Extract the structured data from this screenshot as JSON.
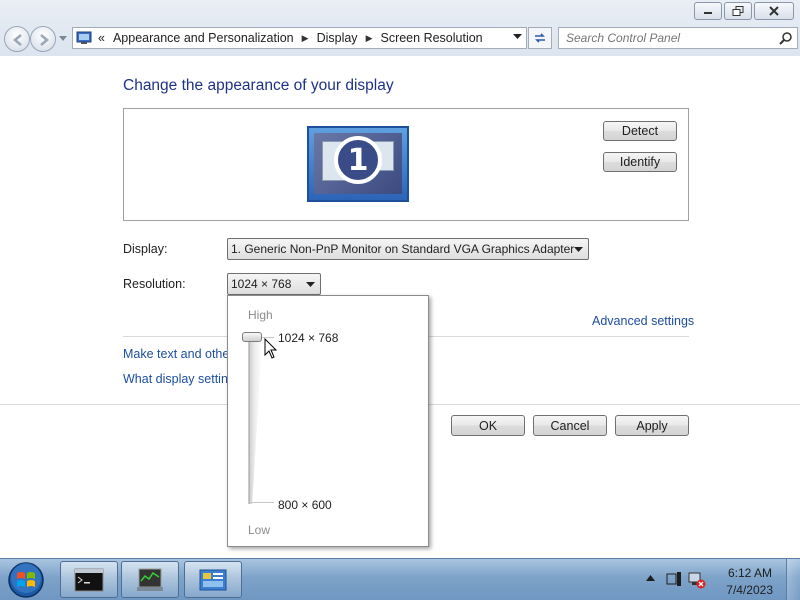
{
  "window": {
    "buttons": {
      "minimize": "minimize-icon",
      "restore": "restore-icon",
      "close": "close-icon"
    }
  },
  "navigation": {
    "back_icon": "back-arrow-icon",
    "forward_icon": "forward-arrow-icon",
    "address": {
      "prefix": "«",
      "crumbs": [
        "Appearance and Personalization",
        "Display",
        "Screen Resolution"
      ]
    },
    "search": {
      "placeholder": "Search Control Panel"
    }
  },
  "main": {
    "title": "Change the appearance of your display",
    "monitor_number": "1",
    "detect_label": "Detect",
    "identify_label": "Identify",
    "display_label": "Display:",
    "display_value": "1. Generic Non-PnP Monitor on Standard VGA Graphics Adapter",
    "resolution_label": "Resolution:",
    "resolution_value": "1024 × 768",
    "advanced_link": "Advanced settings",
    "link_text_size": "Make text and other",
    "link_display_settings": "What display setting",
    "ok_label": "OK",
    "cancel_label": "Cancel",
    "apply_label": "Apply"
  },
  "resolution_popup": {
    "high_label": "High",
    "low_label": "Low",
    "max_resolution": "1024 × 768",
    "min_resolution": "800 × 600",
    "slider_level": 1.0
  },
  "taskbar": {
    "items": [
      "command-prompt-icon",
      "network-monitor-icon",
      "control-panel-icon"
    ],
    "time": "6:12 AM",
    "date": "7/4/2023"
  }
}
